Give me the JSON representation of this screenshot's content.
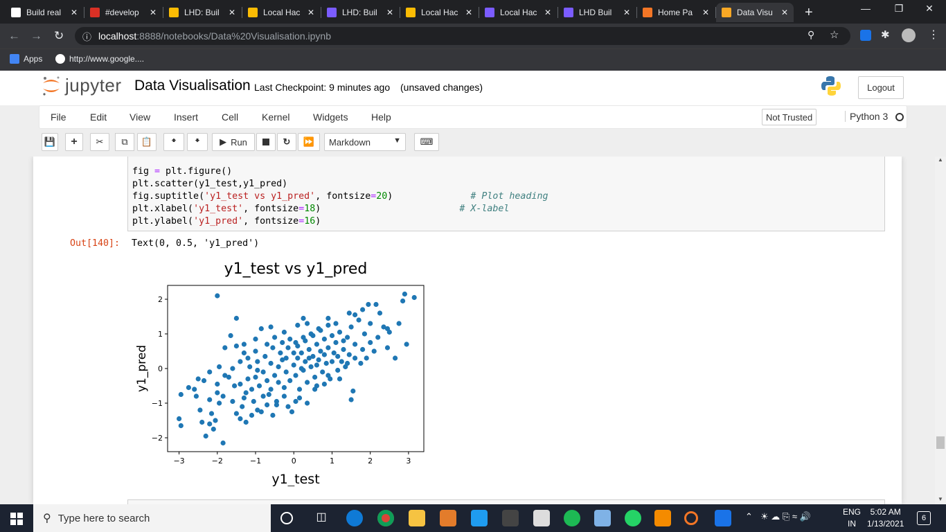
{
  "browser": {
    "tabs": [
      {
        "title": "Build real",
        "icon": "github-icon",
        "color": "#ffffff"
      },
      {
        "title": "#develop",
        "icon": "calendar-icon",
        "color": "#d93025"
      },
      {
        "title": "LHD: Buil",
        "icon": "sparkle-icon",
        "color": "#fbbc04"
      },
      {
        "title": "Local Hac",
        "icon": "sparkle-icon",
        "color": "#fbbc04"
      },
      {
        "title": "LHD: Buil",
        "icon": "list-icon",
        "color": "#7b5cff"
      },
      {
        "title": "Local Hac",
        "icon": "sparkle-icon",
        "color": "#fbbc04"
      },
      {
        "title": "Local Hac",
        "icon": "list-icon",
        "color": "#7b5cff"
      },
      {
        "title": "LHD Buil",
        "icon": "list-icon",
        "color": "#7b5cff"
      },
      {
        "title": "Home Pa",
        "icon": "jupyter-icon",
        "color": "#f37626"
      },
      {
        "title": "Data Visu",
        "icon": "notebook-icon",
        "color": "#f9a825",
        "active": true
      }
    ],
    "new_tab": "+",
    "url_host": "localhost",
    "url_path": ":8888/notebooks/Data%20Visualisation.ipynb",
    "bookmarks": [
      {
        "label": "Apps",
        "icon": "apps-grid-icon"
      },
      {
        "label": "http://www.google....",
        "icon": "google-icon"
      }
    ]
  },
  "jupyter": {
    "logo_text": "jupyter",
    "notebook_title": "Data Visualisation",
    "checkpoint": "Last Checkpoint: 9 minutes ago",
    "unsaved": "(unsaved changes)",
    "logout": "Logout",
    "menus": [
      "File",
      "Edit",
      "View",
      "Insert",
      "Cell",
      "Kernel",
      "Widgets",
      "Help"
    ],
    "trust": "Not Trusted",
    "kernel_name": "Python 3",
    "run_label": "Run",
    "cell_type": "Markdown"
  },
  "cell": {
    "code_lines": [
      [
        {
          "t": "fig "
        },
        {
          "t": "=",
          "c": "o"
        },
        {
          "t": " plt.figure()"
        }
      ],
      [
        {
          "t": "plt.scatter(y1_test,y1_pred)"
        }
      ],
      [
        {
          "t": "fig.suptitle("
        },
        {
          "t": "'y1_test vs y1_pred'",
          "c": "s"
        },
        {
          "t": ", fontsize"
        },
        {
          "t": "=",
          "c": "o"
        },
        {
          "t": "20",
          "c": "n"
        },
        {
          "t": ")              "
        },
        {
          "t": "# Plot heading",
          "c": "c"
        }
      ],
      [
        {
          "t": "plt.xlabel("
        },
        {
          "t": "'y1_test'",
          "c": "s"
        },
        {
          "t": ", fontsize"
        },
        {
          "t": "=",
          "c": "o"
        },
        {
          "t": "18",
          "c": "n"
        },
        {
          "t": ")                         "
        },
        {
          "t": "# X-label",
          "c": "c"
        }
      ],
      [
        {
          "t": "plt.ylabel("
        },
        {
          "t": "'y1_pred'",
          "c": "s"
        },
        {
          "t": ", fontsize"
        },
        {
          "t": "=",
          "c": "o"
        },
        {
          "t": "16",
          "c": "n"
        },
        {
          "t": ")"
        }
      ]
    ],
    "out_prompt": "Out[140]:",
    "out_text": "Text(0, 0.5, 'y1_pred')"
  },
  "chart_data": {
    "type": "scatter",
    "title": "y1_test vs y1_pred",
    "xlabel": "y1_test",
    "ylabel": "y1_pred",
    "xlim": [
      -3.3,
      3.4
    ],
    "ylim": [
      -2.4,
      2.4
    ],
    "xticks": [
      -3,
      -2,
      -1,
      0,
      1,
      2,
      3
    ],
    "yticks": [
      -2,
      -1,
      0,
      1,
      2
    ],
    "color": "#1f77b4",
    "points": [
      [
        -2.0,
        2.1
      ],
      [
        2.9,
        2.15
      ],
      [
        3.15,
        2.05
      ],
      [
        2.85,
        1.95
      ],
      [
        2.15,
        1.85
      ],
      [
        1.95,
        1.85
      ],
      [
        1.8,
        1.7
      ],
      [
        1.45,
        1.6
      ],
      [
        -1.5,
        1.45
      ],
      [
        -0.85,
        1.15
      ],
      [
        -1.65,
        0.95
      ],
      [
        -1.8,
        0.6
      ],
      [
        -1.3,
        0.45
      ],
      [
        -1.95,
        0.05
      ],
      [
        -2.2,
        -0.1
      ],
      [
        -2.5,
        -0.3
      ],
      [
        -2.75,
        -0.55
      ],
      [
        -2.95,
        -0.75
      ],
      [
        -2.55,
        -0.8
      ],
      [
        -3.0,
        -1.45
      ],
      [
        -2.95,
        -1.65
      ],
      [
        -2.4,
        -1.55
      ],
      [
        -2.2,
        -1.6
      ],
      [
        -2.05,
        -1.5
      ],
      [
        -2.3,
        -1.95
      ],
      [
        -1.85,
        -2.15
      ],
      [
        -2.1,
        -1.75
      ],
      [
        -1.4,
        -1.45
      ],
      [
        -1.1,
        -1.35
      ],
      [
        -0.85,
        -1.25
      ],
      [
        2.95,
        0.7
      ],
      [
        2.75,
        1.3
      ],
      [
        2.65,
        0.3
      ],
      [
        2.45,
        1.15
      ],
      [
        2.45,
        0.6
      ],
      [
        1.55,
        -0.65
      ],
      [
        1.5,
        -0.9
      ],
      [
        -2.0,
        -0.45
      ],
      [
        -1.6,
        -0.95
      ],
      [
        -1.25,
        -0.7
      ],
      [
        0.35,
        1.3
      ],
      [
        0.1,
        1.25
      ],
      [
        -0.05,
        -1.25
      ],
      [
        0.55,
        -0.6
      ],
      [
        0.8,
        -0.45
      ],
      [
        -0.45,
        -0.95
      ],
      [
        0.15,
        -0.85
      ],
      [
        1.15,
        0.35
      ],
      [
        1.3,
        0.8
      ],
      [
        0.9,
        1.45
      ],
      [
        -0.4,
        0.05
      ],
      [
        -0.3,
        0.25
      ],
      [
        -0.2,
        -0.1
      ],
      [
        0.0,
        0.1
      ],
      [
        0.1,
        0.3
      ],
      [
        0.2,
        0.45
      ],
      [
        0.3,
        0.2
      ],
      [
        0.4,
        0.55
      ],
      [
        0.5,
        0.35
      ],
      [
        0.6,
        0.7
      ],
      [
        0.7,
        0.5
      ],
      [
        0.8,
        0.85
      ],
      [
        0.9,
        0.6
      ],
      [
        1.0,
        0.95
      ],
      [
        1.1,
        0.75
      ],
      [
        1.2,
        1.05
      ],
      [
        1.3,
        0.55
      ],
      [
        1.4,
        0.9
      ],
      [
        1.5,
        1.2
      ],
      [
        1.6,
        0.7
      ],
      [
        -0.5,
        -0.2
      ],
      [
        -0.6,
        0.15
      ],
      [
        -0.7,
        -0.35
      ],
      [
        -0.8,
        -0.1
      ],
      [
        -0.9,
        -0.5
      ],
      [
        -1.0,
        -0.25
      ],
      [
        -1.1,
        -0.6
      ],
      [
        -1.2,
        -0.3
      ],
      [
        -1.3,
        -0.85
      ],
      [
        -1.4,
        -0.45
      ],
      [
        -0.1,
        -0.35
      ],
      [
        -0.25,
        -0.55
      ],
      [
        0.05,
        -0.2
      ],
      [
        0.25,
        -0.05
      ],
      [
        0.45,
        0.05
      ],
      [
        0.65,
        0.25
      ],
      [
        0.85,
        0.15
      ],
      [
        1.05,
        0.45
      ],
      [
        1.25,
        0.2
      ],
      [
        1.45,
        0.4
      ],
      [
        -0.35,
        0.45
      ],
      [
        -0.15,
        0.6
      ],
      [
        0.05,
        0.75
      ],
      [
        0.25,
        0.9
      ],
      [
        0.45,
        1.0
      ],
      [
        0.65,
        1.15
      ],
      [
        -0.55,
        0.6
      ],
      [
        -0.75,
        0.35
      ],
      [
        -0.95,
        0.2
      ],
      [
        -1.15,
        0.05
      ],
      [
        -0.65,
        -0.75
      ],
      [
        -0.45,
        -1.05
      ],
      [
        -0.25,
        -0.8
      ],
      [
        0.15,
        -0.6
      ],
      [
        0.35,
        -0.4
      ],
      [
        0.55,
        -0.25
      ],
      [
        0.75,
        -0.1
      ],
      [
        0.95,
        -0.3
      ],
      [
        1.15,
        -0.05
      ],
      [
        1.35,
        0.05
      ],
      [
        1.7,
        1.4
      ],
      [
        1.85,
        1.0
      ],
      [
        2.0,
        1.3
      ],
      [
        2.1,
        0.5
      ],
      [
        1.9,
        0.3
      ],
      [
        1.75,
        0.15
      ],
      [
        2.25,
        1.6
      ],
      [
        1.6,
        1.55
      ],
      [
        -1.7,
        -0.25
      ],
      [
        -1.55,
        -0.5
      ],
      [
        -1.85,
        -0.8
      ],
      [
        -1.35,
        -1.1
      ],
      [
        -1.05,
        -0.95
      ],
      [
        -0.95,
        -1.2
      ],
      [
        -0.7,
        -1.05
      ],
      [
        -2.35,
        -0.35
      ],
      [
        -2.6,
        -0.6
      ],
      [
        -2.45,
        -1.2
      ],
      [
        -2.15,
        -1.3
      ],
      [
        -1.95,
        -1.0
      ],
      [
        0.0,
        0.45
      ],
      [
        0.2,
        0.0
      ],
      [
        0.4,
        0.3
      ],
      [
        0.6,
        0.1
      ],
      [
        0.8,
        0.4
      ],
      [
        1.0,
        0.2
      ],
      [
        -0.2,
        0.3
      ],
      [
        -0.4,
        -0.4
      ],
      [
        -0.6,
        -0.6
      ],
      [
        -0.8,
        -0.8
      ],
      [
        0.1,
        0.65
      ],
      [
        0.3,
        0.8
      ],
      [
        0.5,
        0.95
      ],
      [
        0.7,
        1.1
      ],
      [
        0.9,
        1.25
      ],
      [
        1.1,
        1.3
      ],
      [
        -0.1,
        0.85
      ],
      [
        -0.3,
        0.75
      ],
      [
        -0.5,
        0.9
      ],
      [
        -0.7,
        0.7
      ],
      [
        -1.0,
        0.5
      ],
      [
        -1.2,
        0.3
      ],
      [
        -1.4,
        0.2
      ],
      [
        -1.6,
        0.0
      ],
      [
        -1.8,
        -0.2
      ],
      [
        -2.0,
        -0.7
      ],
      [
        -2.2,
        -0.9
      ],
      [
        -1.5,
        -1.3
      ],
      [
        -1.25,
        -1.55
      ],
      [
        -0.55,
        -1.35
      ],
      [
        0.35,
        -1.0
      ],
      [
        0.05,
        -0.95
      ],
      [
        -0.15,
        -1.1
      ],
      [
        0.6,
        -0.5
      ],
      [
        0.9,
        -0.2
      ],
      [
        1.2,
        -0.3
      ],
      [
        1.4,
        0.15
      ],
      [
        1.6,
        0.3
      ],
      [
        1.8,
        0.55
      ],
      [
        2.0,
        0.75
      ],
      [
        2.2,
        0.9
      ],
      [
        2.35,
        1.2
      ],
      [
        2.5,
        1.05
      ],
      [
        0.25,
        1.45
      ],
      [
        -0.25,
        1.05
      ],
      [
        -0.6,
        1.2
      ],
      [
        -1.0,
        0.85
      ],
      [
        -1.3,
        0.7
      ],
      [
        -1.5,
        0.65
      ],
      [
        -0.95,
        -0.05
      ]
    ]
  },
  "taskbar": {
    "search_placeholder": "Type here to search",
    "lang_top": "ENG",
    "lang_bottom": "IN",
    "time": "5:02 AM",
    "date": "1/13/2021",
    "notifications": "6"
  }
}
